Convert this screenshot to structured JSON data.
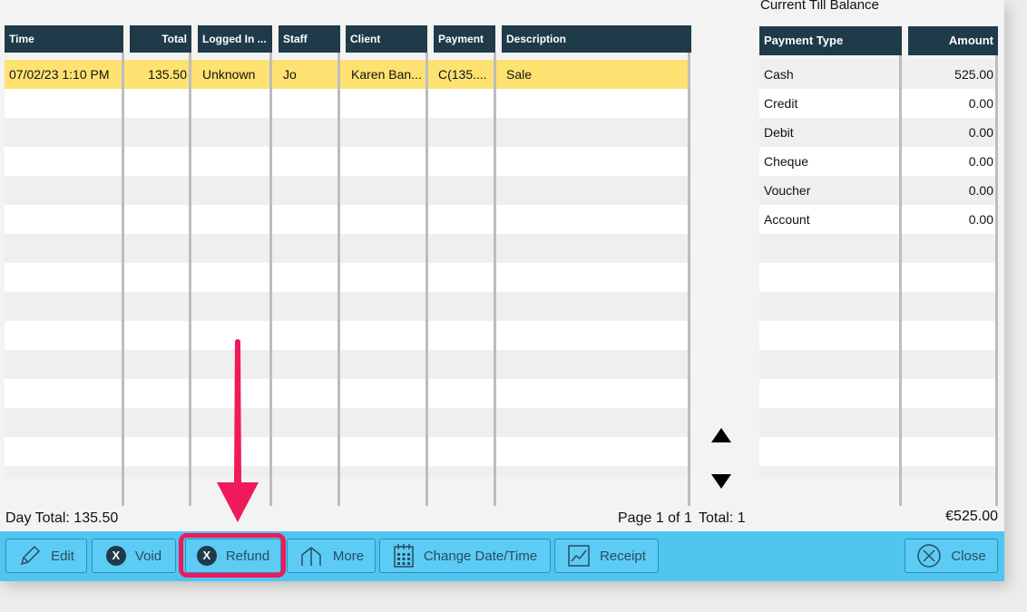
{
  "right_panel": {
    "title": "Current Till Balance",
    "headers": {
      "type": "Payment Type",
      "amount": "Amount"
    },
    "rows": [
      {
        "type": "Cash",
        "amount": "525.00"
      },
      {
        "type": "Credit",
        "amount": "0.00"
      },
      {
        "type": "Debit",
        "amount": "0.00"
      },
      {
        "type": "Cheque",
        "amount": "0.00"
      },
      {
        "type": "Voucher",
        "amount": "0.00"
      },
      {
        "type": "Account",
        "amount": "0.00"
      }
    ],
    "total": "€525.00"
  },
  "table": {
    "headers": {
      "time": "Time",
      "total": "Total",
      "logged_in": "Logged In ...",
      "staff": "Staff",
      "client": "Client",
      "payment": "Payment",
      "description": "Description"
    },
    "rows": [
      {
        "time": "07/02/23 1:10 PM",
        "total": "135.50",
        "logged_in": "Unknown",
        "staff": "Jo",
        "client": "Karen Ban...",
        "payment": "C(135....",
        "description": "Sale"
      }
    ]
  },
  "footer": {
    "day_total": "Day Total: 135.50",
    "page": "Page 1 of 1",
    "total": "Total: 1"
  },
  "toolbar": {
    "edit": "Edit",
    "void": "Void",
    "refund": "Refund",
    "more": "More",
    "change_datetime": "Change Date/Time",
    "receipt": "Receipt",
    "close": "Close",
    "x_glyph": "X"
  },
  "colors": {
    "header_bg": "#1f3a48",
    "selected_row": "#fde272",
    "toolbar_bg": "#4fc5f0",
    "highlight_frame": "#f0195a",
    "annotation_arrow": "#f0195a"
  }
}
